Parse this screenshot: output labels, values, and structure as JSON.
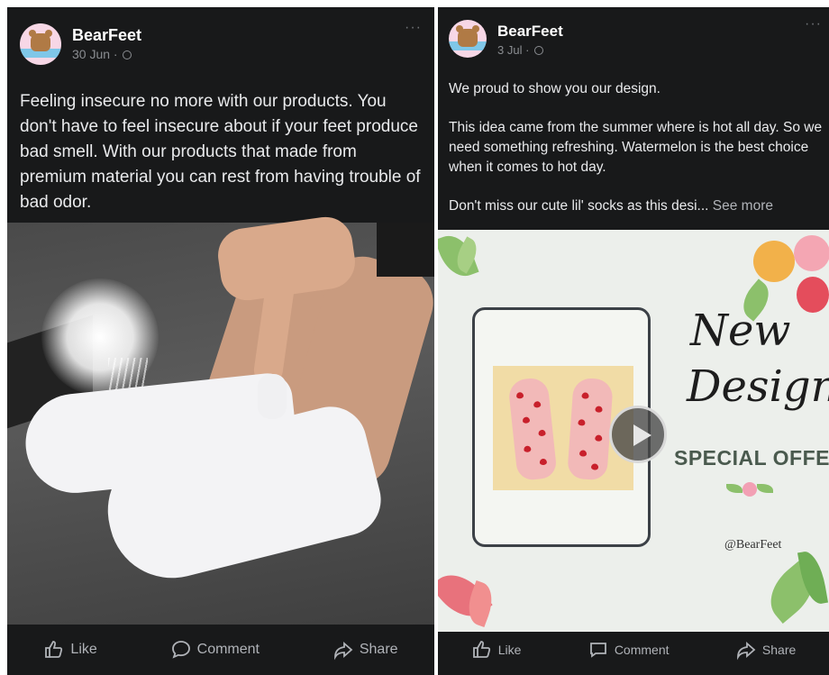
{
  "posts": [
    {
      "author": "BearFeet",
      "date": "30 Jun · ",
      "more": "···",
      "text": "Feeling insecure no more with our products. You don't have to feel insecure about if your feet produce bad smell. With our products that made from premium material you can rest from having trouble of bad odor.",
      "actions": {
        "like": "Like",
        "comment": "Comment",
        "share": "Share"
      }
    },
    {
      "author": "BearFeet",
      "date": "3 Jul · ",
      "more": "···",
      "text_lines": [
        "We proud to show you our design.",
        "This idea came from the summer where is hot all day. So we need something refreshing. Watermelon is the best choice when it comes to hot day.",
        "Don't miss our cute lil' socks as this desi..."
      ],
      "see_more": "See more",
      "image": {
        "title_line1": "New",
        "title_line2": "Design",
        "offer": "SPECIAL OFFER",
        "handle": "@BearFeet"
      },
      "actions": {
        "like": "Like",
        "comment": "Comment",
        "share": "Share"
      }
    }
  ],
  "icons": {
    "like": "thumbs-up-icon",
    "comment": "comment-bubble-icon",
    "share": "share-arrow-icon",
    "privacy": "globe-icon",
    "video": "play-icon"
  },
  "colors": {
    "background": "#18191a",
    "text": "#e4e6eb",
    "muted": "#b0b3b8"
  }
}
